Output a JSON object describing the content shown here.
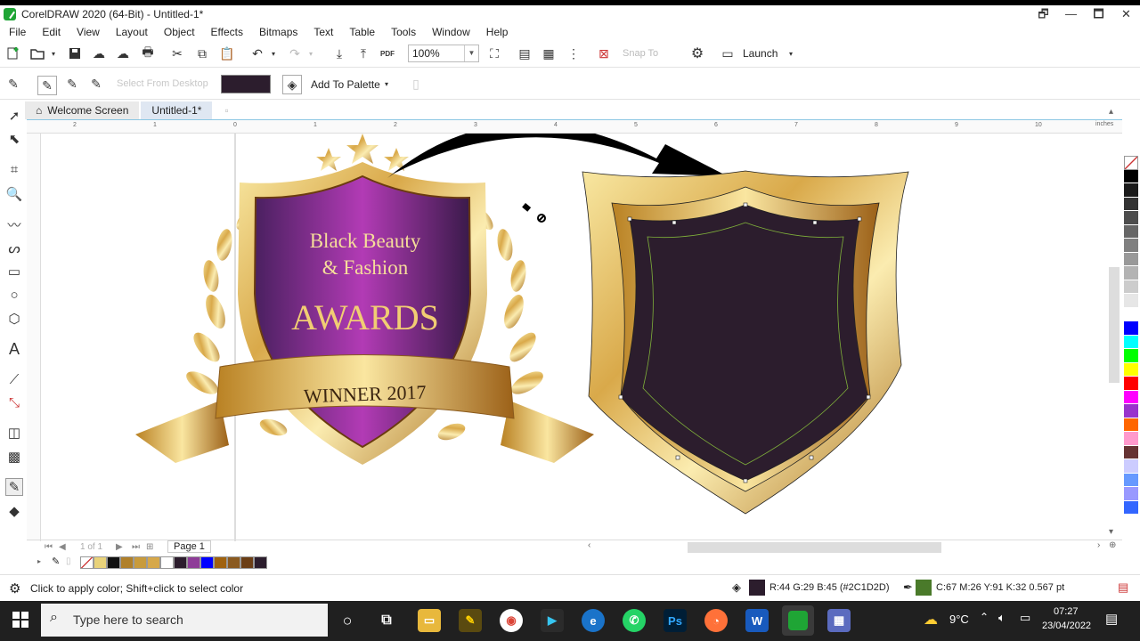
{
  "window": {
    "title": "CorelDRAW 2020 (64-Bit) - Untitled-1*",
    "controls": [
      "🗗",
      "—",
      "🗖",
      "✕"
    ]
  },
  "menu": [
    "File",
    "Edit",
    "View",
    "Layout",
    "Object",
    "Effects",
    "Bitmaps",
    "Text",
    "Table",
    "Tools",
    "Window",
    "Help"
  ],
  "toolbar": {
    "zoom_value": "100%",
    "pdf_label": "PDF",
    "snap_label": "Snap To",
    "launch_label": "Launch"
  },
  "propbar": {
    "select_from_desktop": "Select From Desktop",
    "add_to_palette": "Add To Palette",
    "current_color": "#2C1D2D"
  },
  "tabs": [
    {
      "label": "Welcome Screen"
    },
    {
      "label": "Untitled-1*"
    }
  ],
  "ruler": {
    "top_ticks": [
      "2",
      "1",
      "0",
      "1",
      "2",
      "3",
      "4",
      "5",
      "6",
      "7",
      "8",
      "9",
      "10"
    ],
    "unit": "inches"
  },
  "artwork": {
    "line1": "Black Beauty",
    "line2": "& Fashion",
    "line3": "AWARDS",
    "ribbon": "WINNER 2017"
  },
  "pager": {
    "of_text": "1 of 1",
    "page_label": "Page 1"
  },
  "color_palette": [
    "#000000",
    "#1a1a1a",
    "#333333",
    "#4d4d4d",
    "#666666",
    "#808080",
    "#999999",
    "#b3b3b3",
    "#cccccc",
    "#e6e6e6",
    "#ffffff",
    "#0000ff",
    "#00ffff",
    "#00ff00",
    "#ffff00",
    "#ff0000",
    "#ff00ff",
    "#9933cc",
    "#ff6600",
    "#ff99cc",
    "#663333",
    "#ccccff",
    "#6699ff",
    "#9999ff",
    "#3366ff"
  ],
  "document_palette": [
    "#ffffff",
    "#e8d27a",
    "#111111",
    "#b0802a",
    "#c89b3c",
    "#d6a84a",
    "#ffffff",
    "#2C1D2D",
    "#8e3c98",
    "#0000ff",
    "#a0620f",
    "#8a5a20",
    "#6b3e15",
    "#2C1D2D"
  ],
  "status": {
    "hint": "Click to apply color; Shift+click to select color",
    "fill_info": "R:44 G:29 B:45 (#2C1D2D)",
    "outline_info": "C:67 M:26 Y:91 K:32  0.567 pt",
    "fill_color": "#2C1D2D",
    "outline_color": "#4a7a2a"
  },
  "taskbar": {
    "search_placeholder": "Type here to search",
    "weather": "9°C",
    "time": "07:27",
    "date": "23/04/2022"
  }
}
